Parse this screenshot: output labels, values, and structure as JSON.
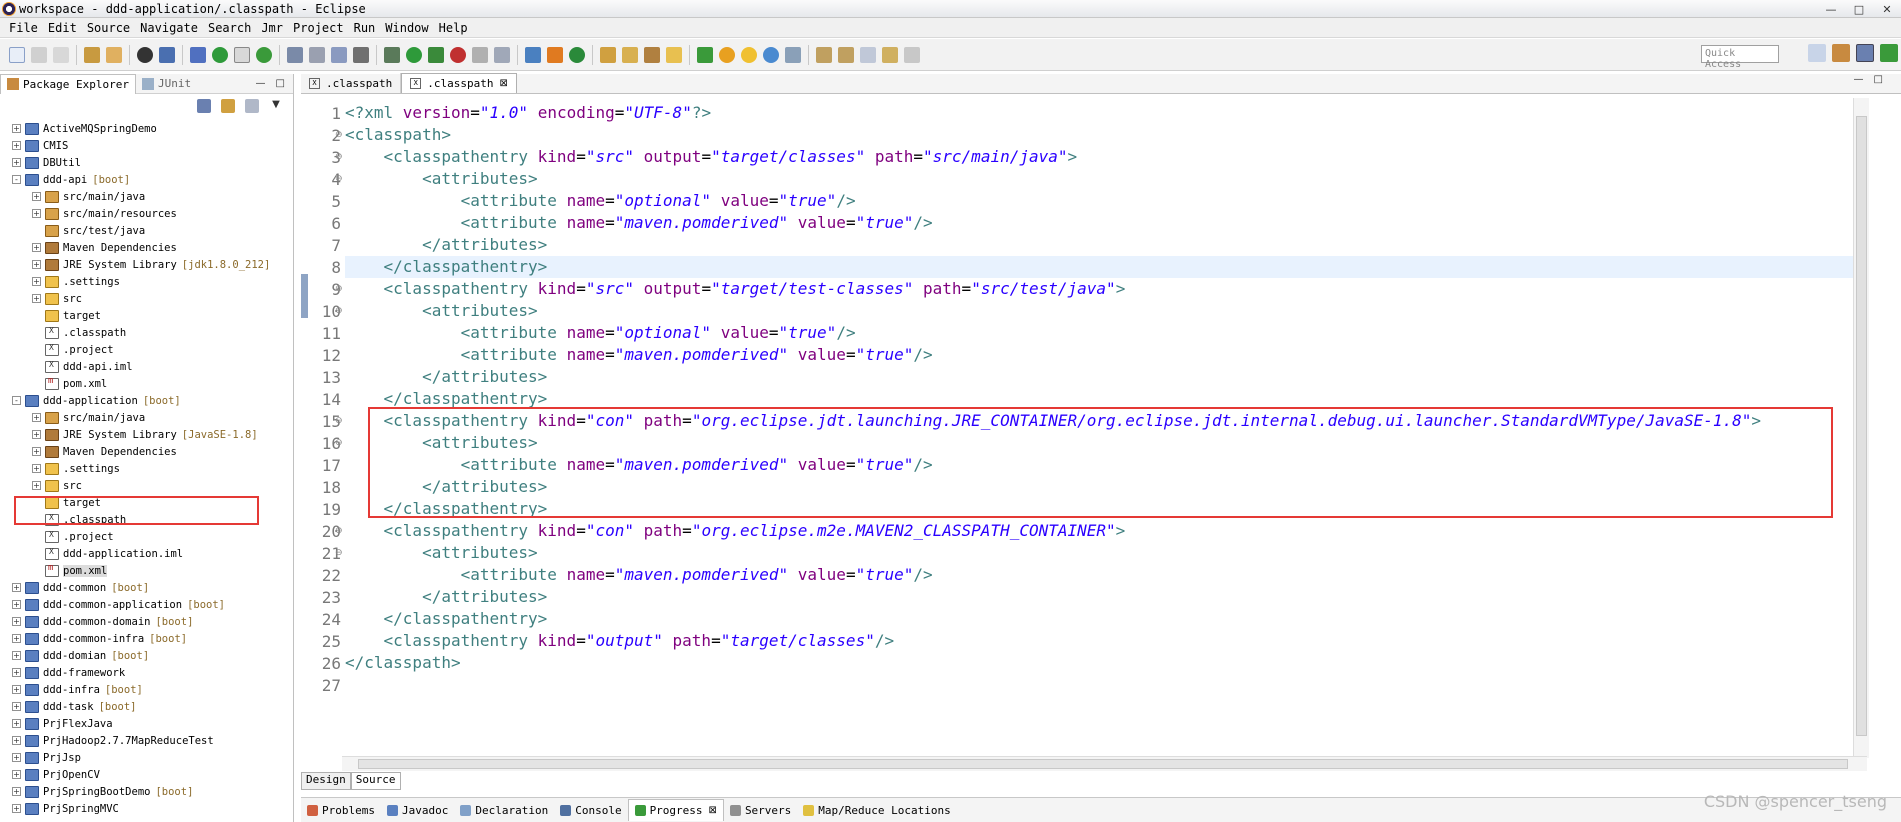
{
  "window": {
    "title": "workspace - ddd-application/.classpath - Eclipse"
  },
  "menu": [
    "File",
    "Edit",
    "Source",
    "Navigate",
    "Search",
    "Jmr",
    "Project",
    "Run",
    "Window",
    "Help"
  ],
  "toolbar": {
    "quick_access": "Quick Access"
  },
  "left_panel": {
    "tabs": [
      {
        "label": "Package Explorer",
        "active": true
      },
      {
        "label": "JUnit",
        "active": false
      }
    ],
    "tree": [
      {
        "level": 0,
        "icon": "project",
        "label": "ActiveMQSpringDemo",
        "exp": "+"
      },
      {
        "level": 0,
        "icon": "project",
        "label": "CMIS",
        "exp": "+"
      },
      {
        "level": 0,
        "icon": "project",
        "label": "DBUtil",
        "exp": "+"
      },
      {
        "level": 0,
        "icon": "project",
        "label": "ddd-api",
        "dec": "[boot]",
        "exp": "-"
      },
      {
        "level": 1,
        "icon": "package",
        "label": "src/main/java",
        "exp": "+"
      },
      {
        "level": 1,
        "icon": "package",
        "label": "src/main/resources",
        "exp": "+"
      },
      {
        "level": 1,
        "icon": "package",
        "label": "src/test/java",
        "exp": ""
      },
      {
        "level": 1,
        "icon": "library",
        "label": "Maven Dependencies",
        "exp": "+"
      },
      {
        "level": 1,
        "icon": "library",
        "label": "JRE System Library",
        "dec": "[jdk1.8.0_212]",
        "exp": "+"
      },
      {
        "level": 1,
        "icon": "folder",
        "label": ".settings",
        "exp": "+"
      },
      {
        "level": 1,
        "icon": "folder",
        "label": "src",
        "exp": "+"
      },
      {
        "level": 1,
        "icon": "folder",
        "label": "target",
        "exp": ""
      },
      {
        "level": 1,
        "icon": "xfile",
        "label": ".classpath",
        "exp": ""
      },
      {
        "level": 1,
        "icon": "xfile",
        "label": ".project",
        "exp": ""
      },
      {
        "level": 1,
        "icon": "xfile",
        "label": "ddd-api.iml",
        "exp": ""
      },
      {
        "level": 1,
        "icon": "maven",
        "label": "pom.xml",
        "exp": ""
      },
      {
        "level": 0,
        "icon": "project",
        "label": "ddd-application",
        "dec": "[boot]",
        "exp": "-"
      },
      {
        "level": 1,
        "icon": "package",
        "label": "src/main/java",
        "exp": "+"
      },
      {
        "level": 1,
        "icon": "library",
        "label": "JRE System Library",
        "dec": "[JavaSE-1.8]",
        "exp": "+"
      },
      {
        "level": 1,
        "icon": "library",
        "label": "Maven Dependencies",
        "exp": "+"
      },
      {
        "level": 1,
        "icon": "folder",
        "label": ".settings",
        "exp": "+"
      },
      {
        "level": 1,
        "icon": "folder",
        "label": "src",
        "exp": "+"
      },
      {
        "level": 1,
        "icon": "folder",
        "label": "target",
        "exp": ""
      },
      {
        "level": 1,
        "icon": "xfile",
        "label": ".classpath",
        "exp": ""
      },
      {
        "level": 1,
        "icon": "xfile",
        "label": ".project",
        "exp": ""
      },
      {
        "level": 1,
        "icon": "xfile",
        "label": "ddd-application.iml",
        "exp": ""
      },
      {
        "level": 1,
        "icon": "maven",
        "label": "pom.xml",
        "exp": "",
        "selected": true
      },
      {
        "level": 0,
        "icon": "project",
        "label": "ddd-common",
        "dec": "[boot]",
        "exp": "+"
      },
      {
        "level": 0,
        "icon": "project",
        "label": "ddd-common-application",
        "dec": "[boot]",
        "exp": "+"
      },
      {
        "level": 0,
        "icon": "project",
        "label": "ddd-common-domain",
        "dec": "[boot]",
        "exp": "+"
      },
      {
        "level": 0,
        "icon": "project",
        "label": "ddd-common-infra",
        "dec": "[boot]",
        "exp": "+"
      },
      {
        "level": 0,
        "icon": "project",
        "label": "ddd-domian",
        "dec": "[boot]",
        "exp": "+"
      },
      {
        "level": 0,
        "icon": "project",
        "label": "ddd-framework",
        "exp": "+"
      },
      {
        "level": 0,
        "icon": "project",
        "label": "ddd-infra",
        "dec": "[boot]",
        "exp": "+"
      },
      {
        "level": 0,
        "icon": "project",
        "label": "ddd-task",
        "dec": "[boot]",
        "exp": "+"
      },
      {
        "level": 0,
        "icon": "project",
        "label": "PrjFlexJava",
        "exp": "+"
      },
      {
        "level": 0,
        "icon": "project",
        "label": "PrjHadoop2.7.7MapReduceTest",
        "exp": "+"
      },
      {
        "level": 0,
        "icon": "project",
        "label": "PrjJsp",
        "exp": "+"
      },
      {
        "level": 0,
        "icon": "project",
        "label": "PrjOpenCV",
        "exp": "+"
      },
      {
        "level": 0,
        "icon": "project",
        "label": "PrjSpringBootDemo",
        "dec": "[boot]",
        "exp": "+"
      },
      {
        "level": 0,
        "icon": "project",
        "label": "PrjSpringMVC",
        "exp": "+"
      }
    ]
  },
  "editor": {
    "tabs": [
      {
        "label": ".classpath",
        "active": false
      },
      {
        "label": ".classpath",
        "active": true
      }
    ],
    "current_line": 8,
    "lines": [
      [
        [
          "pi",
          "<?xml "
        ],
        [
          "att",
          "version"
        ],
        [
          "t",
          "="
        ],
        [
          "val",
          "\"1.0\""
        ],
        [
          "t",
          " "
        ],
        [
          "att",
          "encoding"
        ],
        [
          "t",
          "="
        ],
        [
          "val",
          "\"UTF-8\""
        ],
        [
          "pi",
          "?>"
        ]
      ],
      [
        [
          "tag",
          "<classpath>"
        ]
      ],
      [
        [
          "t",
          "    "
        ],
        [
          "tag",
          "<classpathentry "
        ],
        [
          "att",
          "kind"
        ],
        [
          "t",
          "="
        ],
        [
          "val",
          "\"src\""
        ],
        [
          "t",
          " "
        ],
        [
          "att",
          "output"
        ],
        [
          "t",
          "="
        ],
        [
          "val",
          "\"target/classes\""
        ],
        [
          "t",
          " "
        ],
        [
          "att",
          "path"
        ],
        [
          "t",
          "="
        ],
        [
          "val",
          "\"src/main/java\""
        ],
        [
          "tag",
          ">"
        ]
      ],
      [
        [
          "t",
          "        "
        ],
        [
          "tag",
          "<attributes>"
        ]
      ],
      [
        [
          "t",
          "            "
        ],
        [
          "tag",
          "<attribute "
        ],
        [
          "att",
          "name"
        ],
        [
          "t",
          "="
        ],
        [
          "val",
          "\"optional\""
        ],
        [
          "t",
          " "
        ],
        [
          "att",
          "value"
        ],
        [
          "t",
          "="
        ],
        [
          "val",
          "\"true\""
        ],
        [
          "tag",
          "/>"
        ]
      ],
      [
        [
          "t",
          "            "
        ],
        [
          "tag",
          "<attribute "
        ],
        [
          "att",
          "name"
        ],
        [
          "t",
          "="
        ],
        [
          "val",
          "\"maven.pomderived\""
        ],
        [
          "t",
          " "
        ],
        [
          "att",
          "value"
        ],
        [
          "t",
          "="
        ],
        [
          "val",
          "\"true\""
        ],
        [
          "tag",
          "/>"
        ]
      ],
      [
        [
          "t",
          "        "
        ],
        [
          "tag",
          "</attributes>"
        ]
      ],
      [
        [
          "t",
          "    "
        ],
        [
          "tag",
          "</classpathentry>"
        ]
      ],
      [
        [
          "t",
          "    "
        ],
        [
          "tag",
          "<classpathentry "
        ],
        [
          "att",
          "kind"
        ],
        [
          "t",
          "="
        ],
        [
          "val",
          "\"src\""
        ],
        [
          "t",
          " "
        ],
        [
          "att",
          "output"
        ],
        [
          "t",
          "="
        ],
        [
          "val",
          "\"target/test-classes\""
        ],
        [
          "t",
          " "
        ],
        [
          "att",
          "path"
        ],
        [
          "t",
          "="
        ],
        [
          "val",
          "\"src/test/java\""
        ],
        [
          "tag",
          ">"
        ]
      ],
      [
        [
          "t",
          "        "
        ],
        [
          "tag",
          "<attributes>"
        ]
      ],
      [
        [
          "t",
          "            "
        ],
        [
          "tag",
          "<attribute "
        ],
        [
          "att",
          "name"
        ],
        [
          "t",
          "="
        ],
        [
          "val",
          "\"optional\""
        ],
        [
          "t",
          " "
        ],
        [
          "att",
          "value"
        ],
        [
          "t",
          "="
        ],
        [
          "val",
          "\"true\""
        ],
        [
          "tag",
          "/>"
        ]
      ],
      [
        [
          "t",
          "            "
        ],
        [
          "tag",
          "<attribute "
        ],
        [
          "att",
          "name"
        ],
        [
          "t",
          "="
        ],
        [
          "val",
          "\"maven.pomderived\""
        ],
        [
          "t",
          " "
        ],
        [
          "att",
          "value"
        ],
        [
          "t",
          "="
        ],
        [
          "val",
          "\"true\""
        ],
        [
          "tag",
          "/>"
        ]
      ],
      [
        [
          "t",
          "        "
        ],
        [
          "tag",
          "</attributes>"
        ]
      ],
      [
        [
          "t",
          "    "
        ],
        [
          "tag",
          "</classpathentry>"
        ]
      ],
      [
        [
          "t",
          "    "
        ],
        [
          "tag",
          "<classpathentry "
        ],
        [
          "att",
          "kind"
        ],
        [
          "t",
          "="
        ],
        [
          "val",
          "\"con\""
        ],
        [
          "t",
          " "
        ],
        [
          "att",
          "path"
        ],
        [
          "t",
          "="
        ],
        [
          "val",
          "\"org.eclipse.jdt.launching.JRE_CONTAINER/org.eclipse.jdt.internal.debug.ui.launcher.StandardVMType/JavaSE-1.8\""
        ],
        [
          "tag",
          ">"
        ]
      ],
      [
        [
          "t",
          "        "
        ],
        [
          "tag",
          "<attributes>"
        ]
      ],
      [
        [
          "t",
          "            "
        ],
        [
          "tag",
          "<attribute "
        ],
        [
          "att",
          "name"
        ],
        [
          "t",
          "="
        ],
        [
          "val",
          "\"maven.pomderived\""
        ],
        [
          "t",
          " "
        ],
        [
          "att",
          "value"
        ],
        [
          "t",
          "="
        ],
        [
          "val",
          "\"true\""
        ],
        [
          "tag",
          "/>"
        ]
      ],
      [
        [
          "t",
          "        "
        ],
        [
          "tag",
          "</attributes>"
        ]
      ],
      [
        [
          "t",
          "    "
        ],
        [
          "tag",
          "</classpathentry>"
        ]
      ],
      [
        [
          "t",
          "    "
        ],
        [
          "tag",
          "<classpathentry "
        ],
        [
          "att",
          "kind"
        ],
        [
          "t",
          "="
        ],
        [
          "val",
          "\"con\""
        ],
        [
          "t",
          " "
        ],
        [
          "att",
          "path"
        ],
        [
          "t",
          "="
        ],
        [
          "val",
          "\"org.eclipse.m2e.MAVEN2_CLASSPATH_CONTAINER\""
        ],
        [
          "tag",
          ">"
        ]
      ],
      [
        [
          "t",
          "        "
        ],
        [
          "tag",
          "<attributes>"
        ]
      ],
      [
        [
          "t",
          "            "
        ],
        [
          "tag",
          "<attribute "
        ],
        [
          "att",
          "name"
        ],
        [
          "t",
          "="
        ],
        [
          "val",
          "\"maven.pomderived\""
        ],
        [
          "t",
          " "
        ],
        [
          "att",
          "value"
        ],
        [
          "t",
          "="
        ],
        [
          "val",
          "\"true\""
        ],
        [
          "tag",
          "/>"
        ]
      ],
      [
        [
          "t",
          "        "
        ],
        [
          "tag",
          "</attributes>"
        ]
      ],
      [
        [
          "t",
          "    "
        ],
        [
          "tag",
          "</classpathentry>"
        ]
      ],
      [
        [
          "t",
          "    "
        ],
        [
          "tag",
          "<classpathentry "
        ],
        [
          "att",
          "kind"
        ],
        [
          "t",
          "="
        ],
        [
          "val",
          "\"output\""
        ],
        [
          "t",
          " "
        ],
        [
          "att",
          "path"
        ],
        [
          "t",
          "="
        ],
        [
          "val",
          "\"target/classes\""
        ],
        [
          "tag",
          "/>"
        ]
      ],
      [
        [
          "tag",
          "</classpath>"
        ]
      ],
      []
    ],
    "foldable_lines": [
      2,
      3,
      4,
      9,
      10,
      15,
      16,
      20,
      21
    ],
    "bottom_mode_tabs": [
      {
        "label": "Design",
        "active": false
      },
      {
        "label": "Source",
        "active": true
      }
    ]
  },
  "bottom_panel": {
    "tabs": [
      {
        "label": "Problems",
        "active": false
      },
      {
        "label": "Javadoc",
        "active": false
      },
      {
        "label": "Declaration",
        "active": false
      },
      {
        "label": "Console",
        "active": false
      },
      {
        "label": "Progress",
        "active": true
      },
      {
        "label": "Servers",
        "active": false
      },
      {
        "label": "Map/Reduce Locations",
        "active": false
      }
    ]
  },
  "watermark": "CSDN @spencer_tseng",
  "colors": {
    "highlight_border": "#e53935",
    "xml_tag": "#3f7f7f",
    "xml_attr": "#7f007f",
    "xml_value": "#2a00ff"
  }
}
